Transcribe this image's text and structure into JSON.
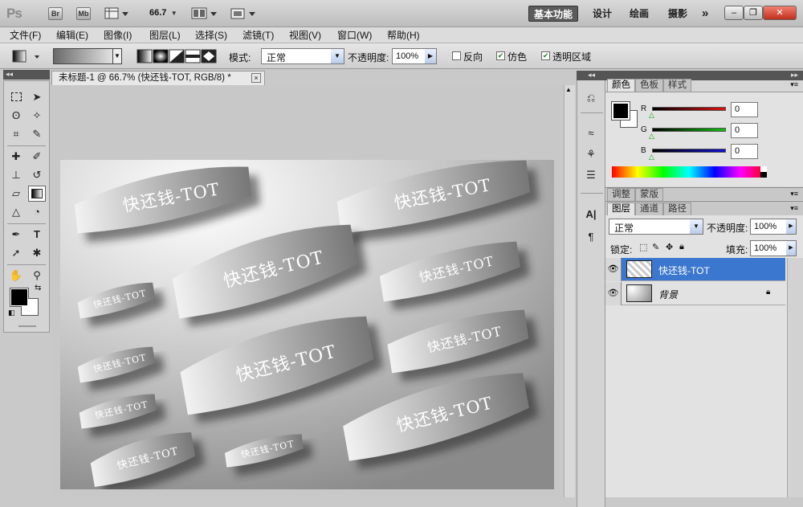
{
  "app": {
    "logo": "Ps",
    "bridge_label": "Br",
    "minibridge_label": "Mb",
    "zoom": "66.7",
    "workspaces": [
      "基本功能",
      "设计",
      "绘画",
      "摄影"
    ],
    "more": "»"
  },
  "menu": [
    "文件(F)",
    "编辑(E)",
    "图像(I)",
    "图层(L)",
    "选择(S)",
    "滤镜(T)",
    "视图(V)",
    "窗口(W)",
    "帮助(H)"
  ],
  "options": {
    "mode_label": "模式:",
    "mode_value": "正常",
    "opacity_label": "不透明度:",
    "opacity_value": "100%",
    "reverse_label": "反向",
    "dither_label": "仿色",
    "transparency_label": "透明区域"
  },
  "document": {
    "tab_title": "未标题-1 @ 66.7% (快还钱-TOT, RGB/8) *",
    "close": "×",
    "text": "快还钱-TOT"
  },
  "color_panel": {
    "tabs": [
      "颜色",
      "色板",
      "样式"
    ],
    "channels": [
      {
        "label": "R",
        "value": "0",
        "color": "#e01010"
      },
      {
        "label": "G",
        "value": "0",
        "color": "#10c010"
      },
      {
        "label": "B",
        "value": "0",
        "color": "#1010d0"
      }
    ]
  },
  "adjust_panel": {
    "tabs": [
      "调整",
      "蒙版"
    ]
  },
  "layers_panel": {
    "tabs": [
      "图层",
      "通道",
      "路径"
    ],
    "blend_mode": "正常",
    "opacity_label": "不透明度:",
    "opacity_value": "100%",
    "lock_label": "锁定:",
    "fill_label": "填充:",
    "fill_value": "100%",
    "layers": [
      {
        "name": "快还钱-TOT",
        "selected": true
      },
      {
        "name": "背景",
        "selected": false
      }
    ]
  }
}
